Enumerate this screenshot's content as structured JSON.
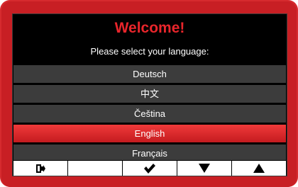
{
  "screen": {
    "title": "Welcome!",
    "subtitle": "Please select your language:"
  },
  "languages": [
    {
      "label": "Deutsch",
      "selected": false
    },
    {
      "label": "中文",
      "selected": false
    },
    {
      "label": "Čeština",
      "selected": false
    },
    {
      "label": "English",
      "selected": true
    },
    {
      "label": "Français",
      "selected": false
    }
  ],
  "softkeys": [
    {
      "icon": "exit-icon"
    },
    {
      "icon": "none"
    },
    {
      "icon": "checkmark-icon"
    },
    {
      "icon": "arrow-down-icon"
    },
    {
      "icon": "arrow-up-icon"
    }
  ],
  "colors": {
    "device": "#d62a2e",
    "title": "#e8252b",
    "selected_row": "#e02a2e",
    "row": "#3c3c3c"
  }
}
